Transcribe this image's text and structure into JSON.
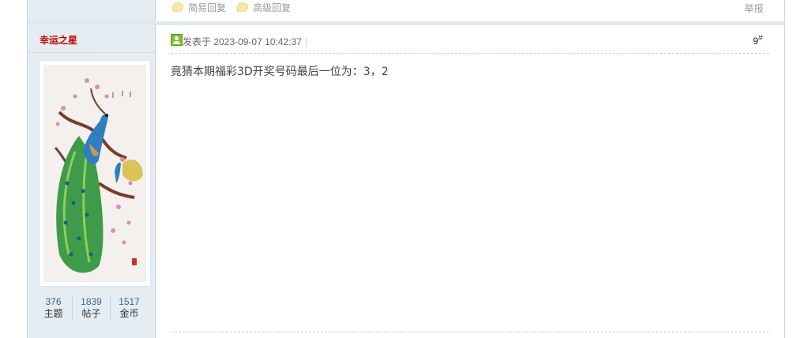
{
  "prev_post": {
    "quick_reply": "简易回复",
    "advanced_reply": "高级回复",
    "report": "举报"
  },
  "author": {
    "name": "幸运之星",
    "stats": [
      {
        "num": "376",
        "label": "主题"
      },
      {
        "num": "1839",
        "label": "帖子"
      },
      {
        "num": "1517",
        "label": "金币"
      }
    ]
  },
  "post": {
    "posted_label": "发表于",
    "posted_time": "2023-09-07 10:42:37",
    "pipe": "|",
    "floor_num": "9",
    "floor_mark": "#",
    "content": "竟猜本期福彩3D开奖号码最后一位为：3，2"
  },
  "colors": {
    "side_bg": "#e5edf2",
    "border": "#c2d5e3",
    "author_name": "#cc0000",
    "stat_link": "#336699"
  }
}
